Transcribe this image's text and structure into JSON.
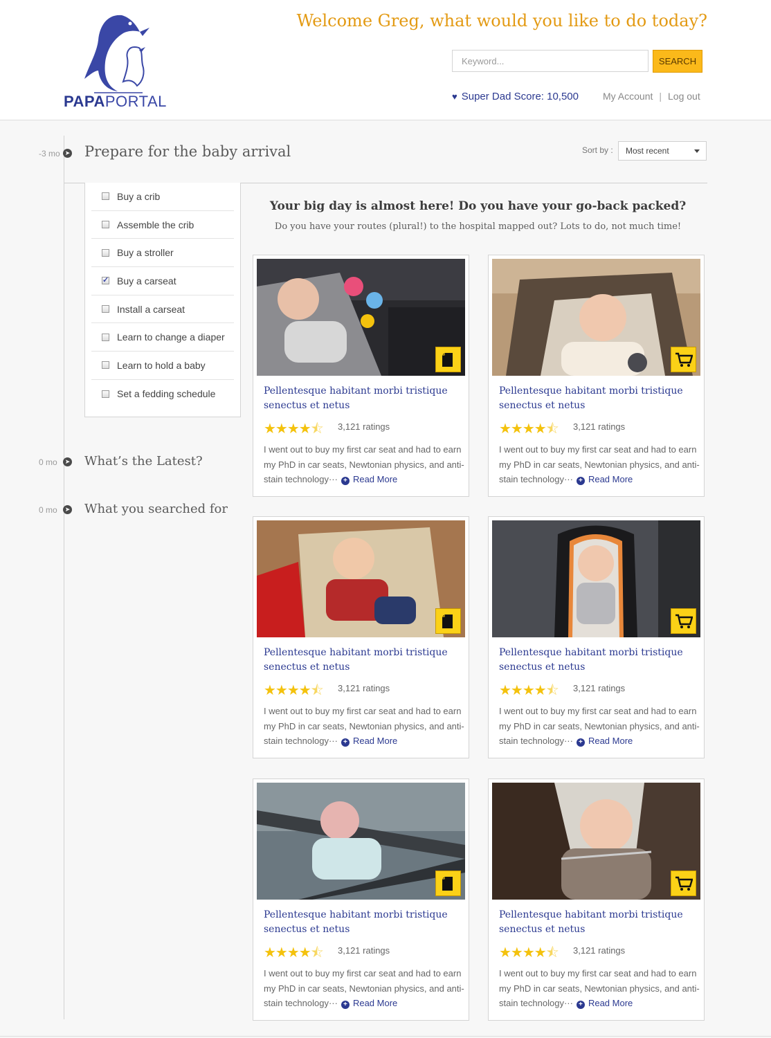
{
  "header": {
    "logo_part1": "PAPA",
    "logo_part2": "PORTAL",
    "welcome": "Welcome Greg, what would you like to do today?",
    "search_placeholder": "Keyword...",
    "search_button": "SEARCH",
    "score_text": "Super Dad Score: 10,500",
    "my_account": "My Account",
    "separator": "|",
    "log_out": "Log out"
  },
  "colors": {
    "brand_blue": "#2b3990",
    "accent_orange": "#e39a13",
    "button_yellow": "#fbb91a",
    "badge_yellow": "#fbd117",
    "star_gold": "#f4c20d"
  },
  "timeline": {
    "sections": [
      {
        "time": "-3 mo",
        "title": "Prepare for the baby arrival"
      },
      {
        "time": "0 mo",
        "title": "What’s the Latest?"
      },
      {
        "time": "0 mo",
        "title": "What you searched for"
      }
    ]
  },
  "sort": {
    "label": "Sort by :",
    "value": "Most recent"
  },
  "checklist": [
    {
      "label": "Buy a crib",
      "checked": false
    },
    {
      "label": "Assemble the crib",
      "checked": false
    },
    {
      "label": "Buy a stroller",
      "checked": false
    },
    {
      "label": "Buy a carseat",
      "checked": true
    },
    {
      "label": "Install a carseat",
      "checked": false
    },
    {
      "label": "Learn to change a diaper",
      "checked": false
    },
    {
      "label": "Learn to hold a baby",
      "checked": false
    },
    {
      "label": "Set a fedding schedule",
      "checked": false
    }
  ],
  "hero": {
    "title": "Your big day is almost here! Do you have your go-back packed?",
    "subtitle": "Do you have your routes (plural!) to the hospital mapped out? Lots to do, not much time!"
  },
  "cards": [
    {
      "title": "Pellentesque habitant morbi tristique senectus et netus",
      "stars": 4.5,
      "ratings": "3,121 ratings",
      "desc": "I went out to buy my first car seat and had to earn my PhD in car seats, Newtonian physics, and anti-stain technology···",
      "read_more": "Read More",
      "badge_icon": "document-icon"
    },
    {
      "title": "Pellentesque habitant morbi tristique senectus et netus",
      "stars": 4.5,
      "ratings": "3,121 ratings",
      "desc": "I went out to buy my first car seat and had to earn my PhD in car seats, Newtonian physics, and anti-stain technology···",
      "read_more": "Read More",
      "badge_icon": "cart-icon"
    },
    {
      "title": "Pellentesque habitant morbi tristique senectus et netus",
      "stars": 4.5,
      "ratings": "3,121 ratings",
      "desc": "I went out to buy my first car seat and had to earn my PhD in car seats, Newtonian physics, and anti-stain technology···",
      "read_more": "Read More",
      "badge_icon": "document-icon"
    },
    {
      "title": "Pellentesque habitant morbi tristique senectus et netus",
      "stars": 4.5,
      "ratings": "3,121 ratings",
      "desc": "I went out to buy my first car seat and had to earn my PhD in car seats, Newtonian physics, and anti-stain technology···",
      "read_more": "Read More",
      "badge_icon": "cart-icon"
    },
    {
      "title": "Pellentesque habitant morbi tristique senectus et netus",
      "stars": 4.5,
      "ratings": "3,121 ratings",
      "desc": "I went out to buy my first car seat and had to earn my PhD in car seats, Newtonian physics, and anti-stain technology···",
      "read_more": "Read More",
      "badge_icon": "document-icon"
    },
    {
      "title": "Pellentesque habitant morbi tristique senectus et netus",
      "stars": 4.5,
      "ratings": "3,121 ratings",
      "desc": "I went out to buy my first car seat and had to earn my PhD in car seats, Newtonian physics, and anti-stain technology···",
      "read_more": "Read More",
      "badge_icon": "cart-icon"
    }
  ]
}
